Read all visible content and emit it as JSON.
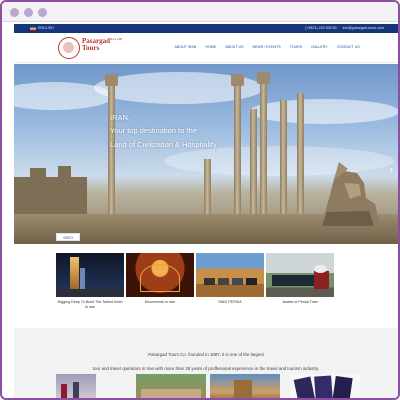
{
  "topbar": {
    "language": "ENGLISH",
    "phone": "(+9821) 226 506 50",
    "email": "info@pasargad-tours.com"
  },
  "header": {
    "logo_text": "Pasargad Tours",
    "logo_since": "Since 1987",
    "nav": [
      "ABOUT IRAN",
      "HOME",
      "ABOUT US",
      "NEWS / EVENTS",
      "TOURS",
      "GALLERY",
      "CONTACT US"
    ]
  },
  "hero": {
    "line1": "IRAN,",
    "line2": "Your top destination to the",
    "line3": "Land of Civilization & Hospitality",
    "prev_arrow": "‹",
    "next_arrow": "›"
  },
  "badge": "VIDEO",
  "cards": [
    {
      "title": "Digging Deep To Build The Tallest Hotel in Iran"
    },
    {
      "title": "Monuments in Iran"
    },
    {
      "title": "RAID PERSIA"
    },
    {
      "title": "Jewels of Persia Train"
    }
  ],
  "about": {
    "line1": "Pasargad Tours Co. founded in 1987, it is one of the largest",
    "line2": "tour and travel operators in Iran with more than 28 years of proffesional experience in the travel and tourism industry."
  },
  "colors": {
    "topbar": "#16357a",
    "nav": "#1f4f9a",
    "logo": "#c0322c",
    "frame": "#8a4fa0"
  }
}
